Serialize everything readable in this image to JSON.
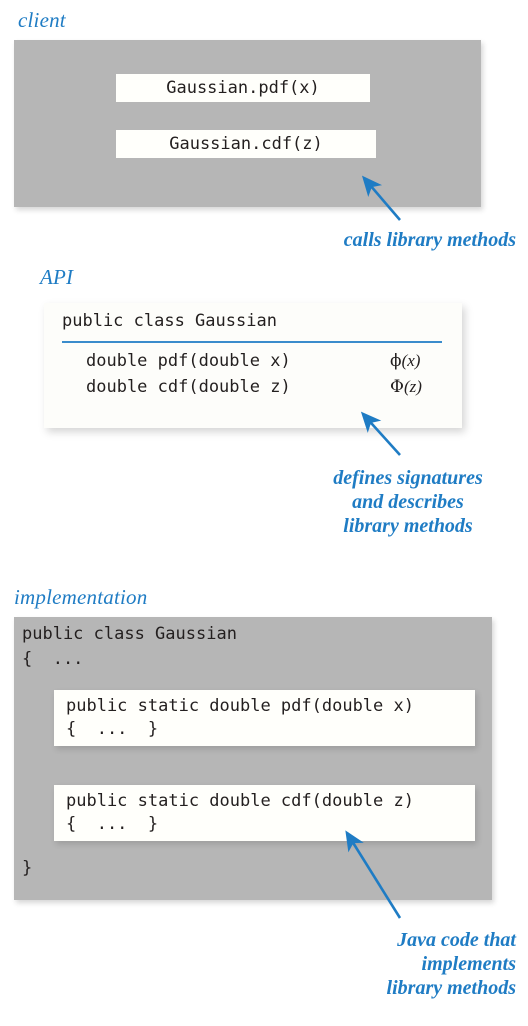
{
  "diagram": {
    "title": "Library abstraction: client, API, and implementation",
    "accent_blue": "#1f7cc4",
    "panel_gray": "#b6b6b6",
    "code_white": "#fffffb"
  },
  "client": {
    "label": "client",
    "calls": [
      "Gaussian.pdf(x)",
      "Gaussian.cdf(z)"
    ],
    "annotation": "calls library methods"
  },
  "api": {
    "label": "API",
    "class_declaration": "public class Gaussian",
    "methods": [
      {
        "signature": "double pdf(double x)",
        "symbol": "ϕ",
        "argument": "(x)"
      },
      {
        "signature": "double cdf(double z)",
        "symbol": "Φ",
        "argument": "(z)"
      }
    ],
    "annotation": "defines signatures\nand describes\nlibrary methods"
  },
  "implementation": {
    "label": "implementation",
    "class_header": "public class Gaussian\n{  ...",
    "class_footer": "}",
    "methods": [
      {
        "signature": "public static double pdf(double x)",
        "body": "{  ...  }"
      },
      {
        "signature": "public static double cdf(double z)",
        "body": "{  ...  }"
      }
    ],
    "annotation": "Java code that\nimplements\nlibrary methods"
  }
}
